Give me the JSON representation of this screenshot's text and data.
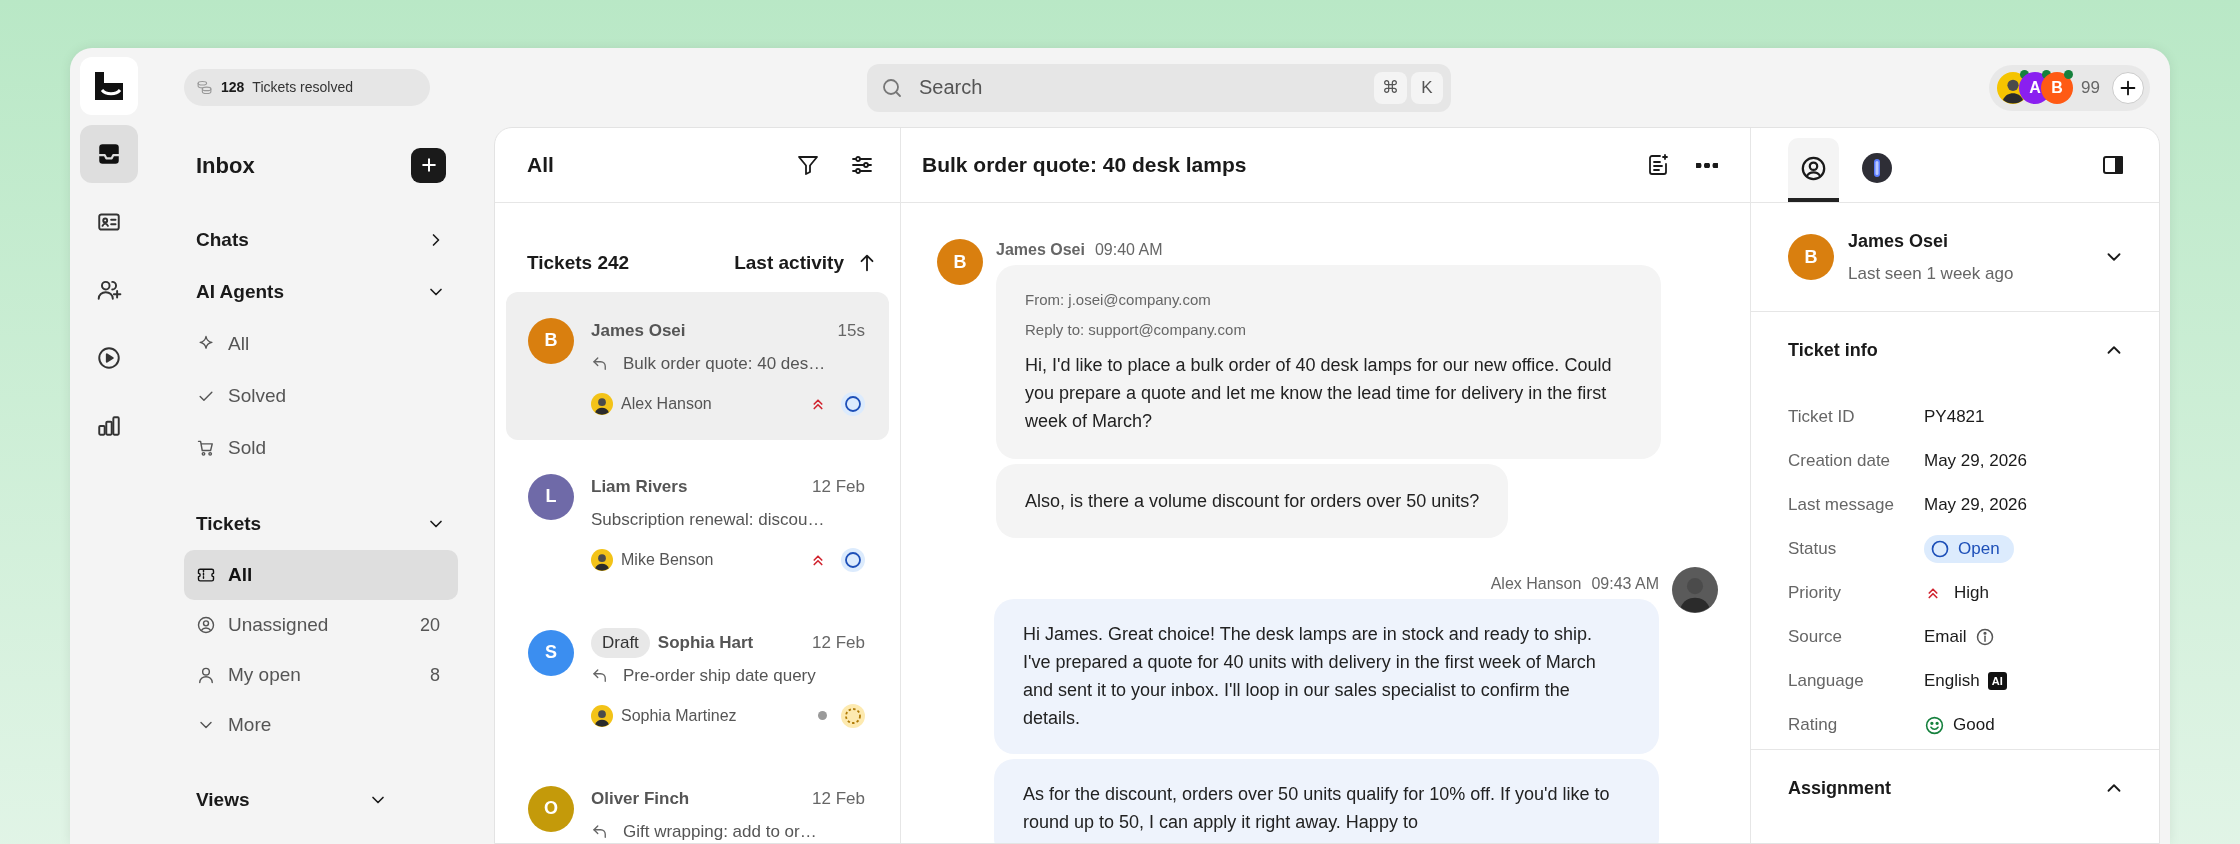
{
  "top_bar": {
    "resolved": {
      "count": "128",
      "label": "Tickets resolved"
    },
    "search": {
      "placeholder": "Search",
      "shortcut": [
        "⌘",
        "K"
      ]
    },
    "agents": [
      {
        "kind": "photo",
        "color": "#f5c400",
        "online": true
      },
      {
        "kind": "initial",
        "initial": "A",
        "color": "#8a1ff0",
        "online": true
      },
      {
        "kind": "initial",
        "initial": "B",
        "color": "#ff5a14",
        "online": true
      }
    ],
    "agents_more": "99"
  },
  "rail": [
    {
      "kind": "inbox",
      "selected": true
    },
    {
      "kind": "contact-card",
      "selected": false
    },
    {
      "kind": "users-plus",
      "selected": false
    },
    {
      "kind": "play",
      "selected": false
    },
    {
      "kind": "chart",
      "selected": false
    }
  ],
  "sidebar": {
    "title": "Inbox",
    "sections": [
      {
        "title": "Chats",
        "expanded": false
      },
      {
        "title": "AI Agents",
        "expanded": true,
        "items": [
          {
            "kind": "sparkle",
            "label": "All",
            "selected": false
          },
          {
            "kind": "check",
            "label": "Solved",
            "selected": false
          },
          {
            "kind": "cart",
            "label": "Sold",
            "selected": false
          }
        ]
      },
      {
        "title": "Tickets",
        "expanded": true,
        "items": [
          {
            "kind": "ticket",
            "label": "All",
            "selected": true
          },
          {
            "kind": "user-circle",
            "label": "Unassigned",
            "count": "20",
            "selected": false
          },
          {
            "kind": "user",
            "label": "My open",
            "count": "8",
            "selected": false
          },
          {
            "kind": "chevron",
            "label": "More",
            "selected": false
          }
        ]
      },
      {
        "title": "Views",
        "expanded": true
      }
    ]
  },
  "ticket_list": {
    "title": "All",
    "count_label": "Tickets 242",
    "sort_label": "Last activity",
    "tickets": [
      {
        "initial": "B",
        "color": "#d97f0f",
        "name": "James Osei",
        "time": "15s",
        "replied": true,
        "subject": "Bulk order quote: 40 des…",
        "assignee": "Alex Hanson",
        "priority": {
          "kind": "high"
        },
        "status": {
          "kind": "open"
        },
        "selected": true
      },
      {
        "initial": "L",
        "color": "#6f6aa8",
        "name": "Liam Rivers",
        "time": "12 Feb",
        "replied": false,
        "subject": "Subscription renewal: discou…",
        "assignee": "Mike Benson",
        "priority": {
          "kind": "high"
        },
        "status": {
          "kind": "open"
        },
        "selected": false
      },
      {
        "initial": "S",
        "color": "#3b8ef0",
        "tag": "Draft",
        "name": "Sophia Hart",
        "time": "12 Feb",
        "replied": true,
        "subject": "Pre-order ship date query",
        "assignee": "Sophia Martinez",
        "priority": {
          "kind": "none"
        },
        "status": {
          "kind": "pending"
        },
        "selected": false
      },
      {
        "initial": "O",
        "color": "#c49a0a",
        "name": "Oliver Finch",
        "time": "12 Feb",
        "replied": true,
        "subject": "Gift wrapping: add to or…",
        "selected": false
      }
    ]
  },
  "conversation": {
    "title": "Bulk order quote: 40 desk lamps",
    "messages": [
      {
        "kind": "inbound",
        "author": "James Osei",
        "time": "09:40 AM",
        "initial": "B",
        "color": "#d97f0f",
        "bubbles": [
          {
            "from": "From: j.osei@company.com",
            "reply_to": "Reply to: support@company.com",
            "text": "Hi, I'd like to place a bulk order of 40 desk lamps for our new office. Could you prepare a quote and let me know the lead time for delivery in the first week of March?"
          },
          {
            "text": "Also, is there a volume discount for orders over 50 units?"
          }
        ]
      },
      {
        "kind": "outbound",
        "author": "Alex Hanson",
        "time": "09:43 AM",
        "bubbles": [
          {
            "text": "Hi James. Great choice! The desk lamps are in stock and ready to ship. I've prepared a quote for 40 units with delivery in the first week of March and sent it to your inbox. I'll loop in our sales specialist to confirm the details."
          },
          {
            "text": "As for the discount, orders over 50 units qualify for 10% off. If you'd like to round up to 50, I can apply it right away. Happy to"
          }
        ]
      }
    ]
  },
  "details": {
    "tabs": [
      {
        "kind": "person",
        "selected": true
      },
      {
        "kind": "orb",
        "selected": false
      }
    ],
    "contact": {
      "initial": "B",
      "color": "#d97f0f",
      "name": "James Osei",
      "last_seen": "Last seen 1 week ago",
      "expanded": false
    },
    "sections": [
      {
        "title": "Ticket info",
        "expanded": true,
        "fields": [
          {
            "kind": "text",
            "label": "Ticket ID",
            "value": "PY4821"
          },
          {
            "kind": "text",
            "label": "Creation date",
            "value": "May 29, 2026"
          },
          {
            "kind": "text",
            "label": "Last message",
            "value": "May 29, 2026"
          },
          {
            "kind": "status",
            "label": "Status",
            "value": "Open"
          },
          {
            "kind": "priority",
            "label": "Priority",
            "value": "High"
          },
          {
            "kind": "source",
            "label": "Source",
            "value": "Email"
          },
          {
            "kind": "language",
            "label": "Language",
            "value": "English",
            "badge": "AI"
          },
          {
            "kind": "rating",
            "label": "Rating",
            "value": "Good"
          }
        ]
      },
      {
        "title": "Assignment",
        "expanded": true
      }
    ]
  }
}
